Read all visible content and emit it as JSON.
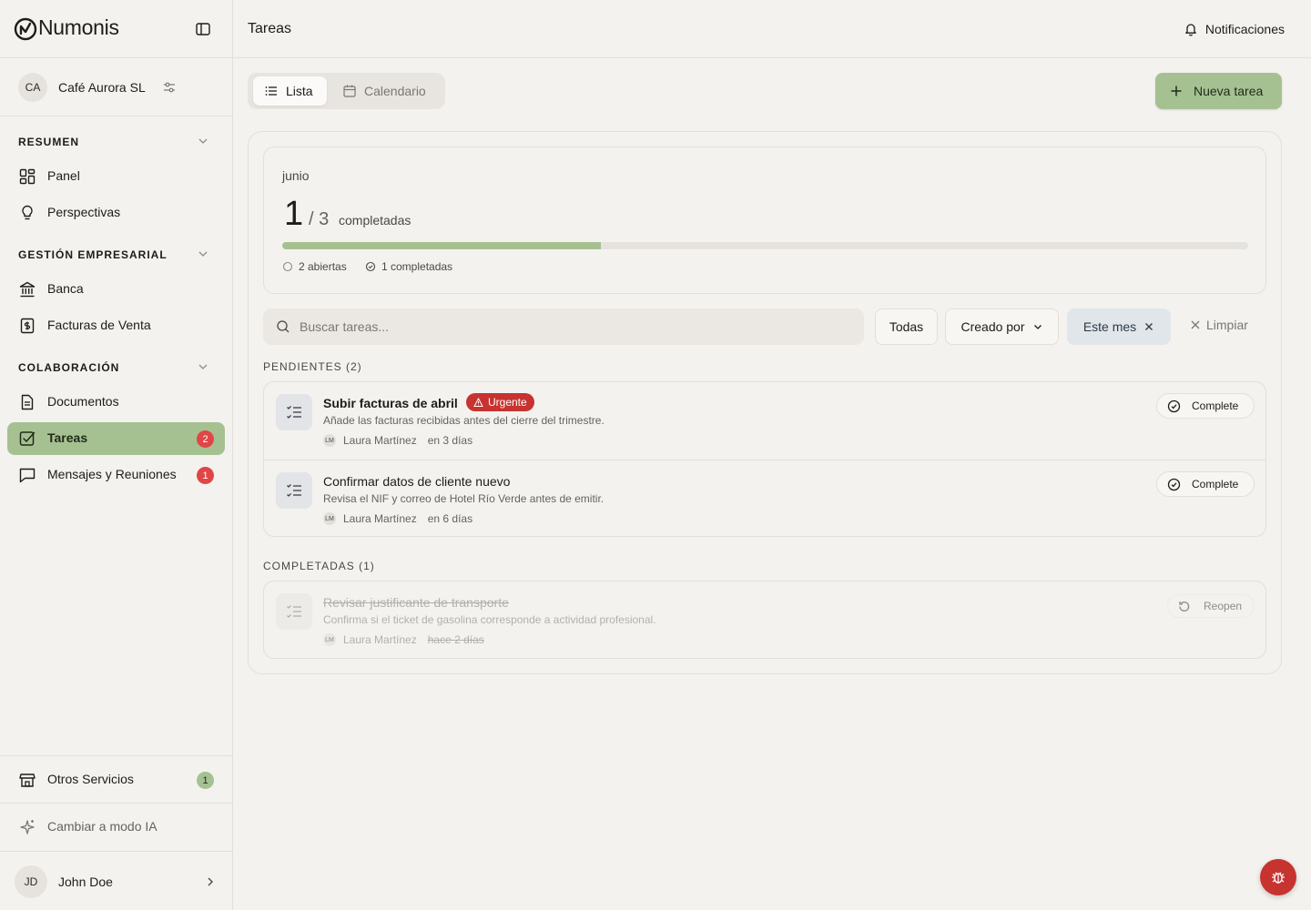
{
  "app": {
    "name": "Numonis"
  },
  "company": {
    "initials": "CA",
    "name": "Café Aurora SL"
  },
  "nav": {
    "sections": [
      {
        "title": "RESUMEN",
        "items": [
          {
            "label": "Panel"
          },
          {
            "label": "Perspectivas"
          }
        ]
      },
      {
        "title": "GESTIÓN EMPRESARIAL",
        "items": [
          {
            "label": "Banca"
          },
          {
            "label": "Facturas de Venta"
          }
        ]
      },
      {
        "title": "COLABORACIÓN",
        "items": [
          {
            "label": "Documentos"
          },
          {
            "label": "Tareas",
            "badge": "2",
            "active": true
          },
          {
            "label": "Mensajes y Reuniones",
            "badge": "1"
          }
        ]
      }
    ]
  },
  "footer": {
    "services": {
      "label": "Otros Servicios",
      "badge": "1"
    },
    "ai_mode": {
      "label": "Cambiar a modo IA"
    },
    "user": {
      "initials": "JD",
      "name": "John Doe"
    }
  },
  "header": {
    "title": "Tareas",
    "notifications_label": "Notificaciones"
  },
  "views": {
    "list_label": "Lista",
    "calendar_label": "Calendario",
    "active": "Lista"
  },
  "new_task_label": "Nueva tarea",
  "summary": {
    "month": "junio",
    "completed": "1",
    "total_text": "/ 3",
    "completed_label": "completadas",
    "progress_fraction": 0.33,
    "open_stat": "2 abiertas",
    "done_stat": "1 completadas"
  },
  "filters": {
    "search_placeholder": "Buscar tareas...",
    "all_label": "Todas",
    "created_by_label": "Creado por",
    "this_month_label": "Este mes",
    "clear_label": "Limpiar"
  },
  "pending": {
    "header": "PENDIENTES (2)",
    "tasks": [
      {
        "title": "Subir facturas de abril",
        "badge": "Urgente",
        "description": "Añade las facturas recibidas antes del cierre del trimestre.",
        "assignee_initials": "LM",
        "assignee": "Laura Martínez",
        "due": "en 3 días",
        "action": "Complete"
      },
      {
        "title": "Confirmar datos de cliente nuevo",
        "description": "Revisa el NIF y correo de Hotel Río Verde antes de emitir.",
        "assignee_initials": "LM",
        "assignee": "Laura Martínez",
        "due": "en 6 días",
        "action": "Complete"
      }
    ]
  },
  "completed": {
    "header": "COMPLETADAS (1)",
    "tasks": [
      {
        "title": "Revisar justificante de transporte",
        "description": "Confirma si el ticket de gasolina corresponde a actividad profesional.",
        "assignee_initials": "LM",
        "assignee": "Laura Martínez",
        "due": "hace 2 días",
        "action": "Reopen"
      }
    ]
  },
  "colors": {
    "accent": "#a6c191",
    "urgent": "#c7332f",
    "badge": "#e04646",
    "background": "#f4f2ef"
  }
}
